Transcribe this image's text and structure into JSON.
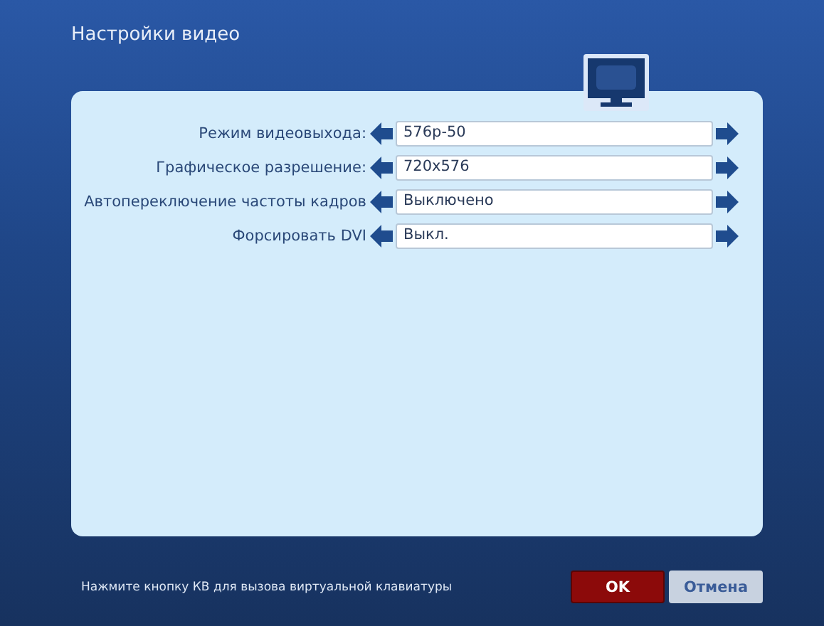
{
  "title": "Настройки видео",
  "settings": [
    {
      "label": "Режим видеовыхода:",
      "value": "576p-50"
    },
    {
      "label": "Графическое разрешение:",
      "value": "720x576"
    },
    {
      "label": "Автопереключение частоты кадров",
      "value": "Выключено"
    },
    {
      "label": "Форсировать DVI",
      "value": "Выкл."
    }
  ],
  "hint": "Нажмите кнопку КВ для вызова виртуальной клавиатуры",
  "buttons": [
    {
      "label": "OK",
      "selected": true
    },
    {
      "label": "Отмена",
      "selected": false
    }
  ]
}
